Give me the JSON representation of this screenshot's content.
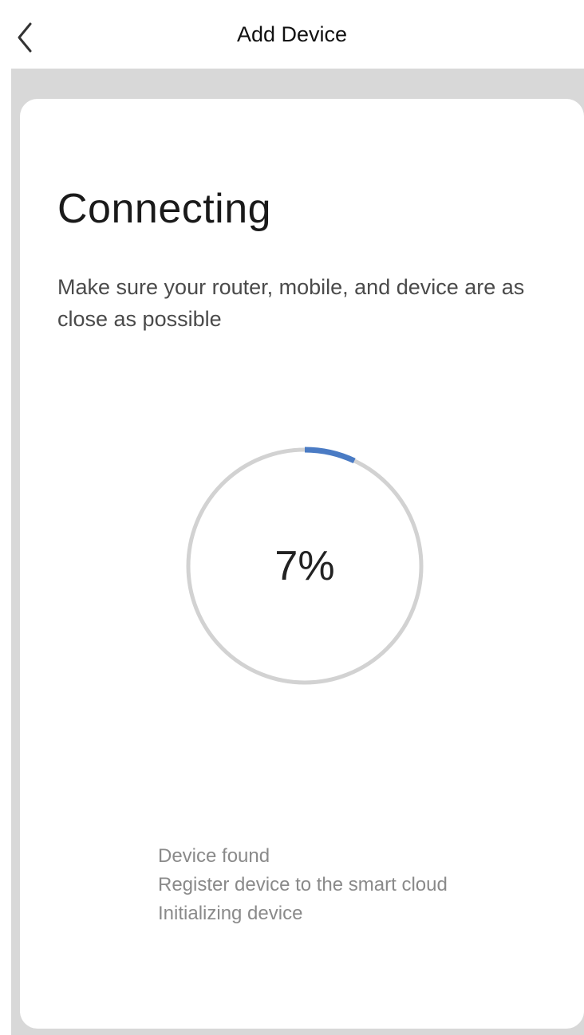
{
  "header": {
    "title": "Add Device",
    "back_icon": "chevron-left-icon"
  },
  "main": {
    "heading": "Connecting",
    "subtitle": "Make sure your router, mobile, and device are as close as possible",
    "progress": {
      "value_text": "7%",
      "fraction": 0.07,
      "track_color": "#d2d2d2",
      "fill_color": "#4a7bc4"
    },
    "steps": [
      "Device found",
      "Register device to the smart cloud",
      "Initializing device"
    ]
  }
}
